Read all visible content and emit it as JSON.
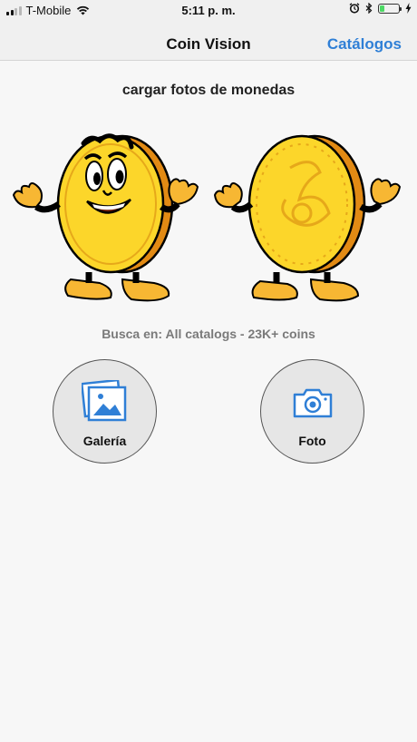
{
  "status_bar": {
    "carrier": "T-Mobile",
    "time": "5:11 p. m.",
    "battery_level": 0.25,
    "battery_color": "#4cd964"
  },
  "navbar": {
    "title": "Coin Vision",
    "right_action": "Catálogos",
    "accent_color": "#2f7fd6"
  },
  "main": {
    "heading": "cargar fotos de monedas",
    "subtitle": "Busca en: All catalogs - 23K+ coins",
    "buttons": [
      {
        "label": "Galería",
        "icon": "photo-gallery-icon"
      },
      {
        "label": "Foto",
        "icon": "camera-icon"
      }
    ]
  }
}
